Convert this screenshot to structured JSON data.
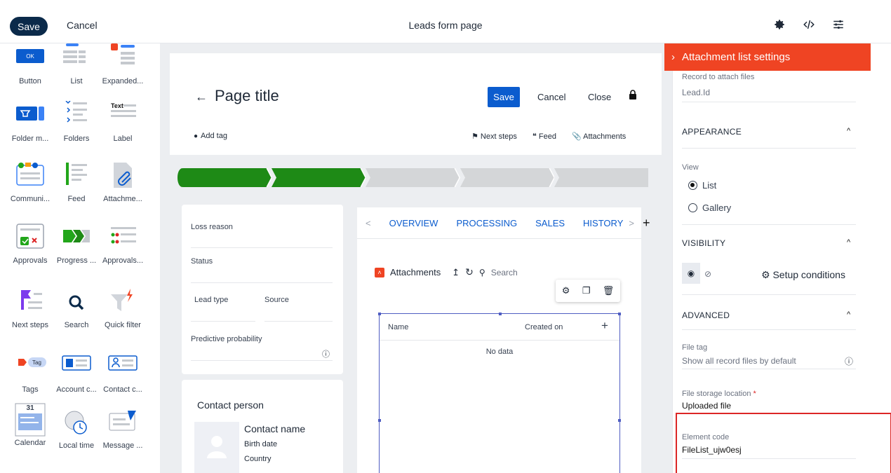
{
  "topbar": {
    "save": "Save",
    "cancel": "Cancel",
    "title": "Leads form page",
    "icons": [
      "settings-gear-icon",
      "code-icon",
      "sliders-icon"
    ]
  },
  "palette": [
    {
      "label": "Button",
      "icon": "button-icon",
      "badge": "OK"
    },
    {
      "label": "List",
      "icon": "list-icon"
    },
    {
      "label": "Expanded...",
      "icon": "expanded-list-icon"
    },
    {
      "label": "Folder m...",
      "icon": "folder-manager-icon"
    },
    {
      "label": "Folders",
      "icon": "folders-icon"
    },
    {
      "label": "Label",
      "icon": "label-icon",
      "badge": "Text"
    },
    {
      "label": "Communi...",
      "icon": "communication-icon"
    },
    {
      "label": "Feed",
      "icon": "feed-icon"
    },
    {
      "label": "Attachme...",
      "icon": "attachment-icon"
    },
    {
      "label": "Approvals",
      "icon": "approvals-icon"
    },
    {
      "label": "Progress ...",
      "icon": "progress-bar-icon"
    },
    {
      "label": "Approvals...",
      "icon": "approvals-list-icon"
    },
    {
      "label": "Next steps",
      "icon": "next-steps-icon"
    },
    {
      "label": "Search",
      "icon": "search-icon"
    },
    {
      "label": "Quick filter",
      "icon": "quick-filter-icon"
    },
    {
      "label": "Tags",
      "icon": "tags-icon",
      "badge": "Tag"
    },
    {
      "label": "Account c...",
      "icon": "account-card-icon"
    },
    {
      "label": "Contact c...",
      "icon": "contact-card-icon"
    },
    {
      "label": "Calendar",
      "icon": "calendar-icon",
      "badge": "31"
    },
    {
      "label": "Local time",
      "icon": "local-time-icon"
    },
    {
      "label": "Message ...",
      "icon": "message-icon"
    }
  ],
  "header": {
    "back": "←",
    "title": "Page title",
    "save": "Save",
    "cancel": "Cancel",
    "close": "Close",
    "add_tag": "Add tag",
    "next_steps": "Next steps",
    "feed": "Feed",
    "attachments": "Attachments"
  },
  "progress": {
    "total": 5,
    "completed": 2,
    "colors": {
      "done": "#1e8a16",
      "todo": "#d4d6d8"
    }
  },
  "fields": {
    "loss_reason": "Loss reason",
    "status": "Status",
    "lead_type": "Lead type",
    "source": "Source",
    "predictive": "Predictive probability"
  },
  "contact": {
    "title": "Contact person",
    "name": "Contact name",
    "birth": "Birth date",
    "country": "Country"
  },
  "tabs": {
    "items": [
      "OVERVIEW",
      "PROCESSING",
      "SALES",
      "HISTORY"
    ],
    "prev": "<",
    "next": ">",
    "add": "+"
  },
  "attachments": {
    "title": "Attachments",
    "search_placeholder": "Search",
    "col_name": "Name",
    "col_created": "Created on",
    "add": "+",
    "empty": "No data"
  },
  "settings": {
    "title": "Attachment list settings",
    "record_label": "Record to attach files",
    "record_value": "Lead.Id",
    "appearance": "APPEARANCE",
    "view_label": "View",
    "view_options": [
      "List",
      "Gallery"
    ],
    "view_selected": "List",
    "visibility": "VISIBILITY",
    "setup_conditions": "Setup conditions",
    "advanced": "ADVANCED",
    "file_tag_label": "File tag",
    "file_tag_placeholder": "Show all record files by default",
    "storage_label": "File storage location",
    "required_mark": "*",
    "storage_value": "Uploaded file",
    "code_label": "Element code",
    "code_value": "FileList_ujw0esj"
  },
  "colors": {
    "accent": "#ef4423",
    "primary": "#0b5cce",
    "dark": "#0b2a4a",
    "highlight": "#dc2626"
  }
}
